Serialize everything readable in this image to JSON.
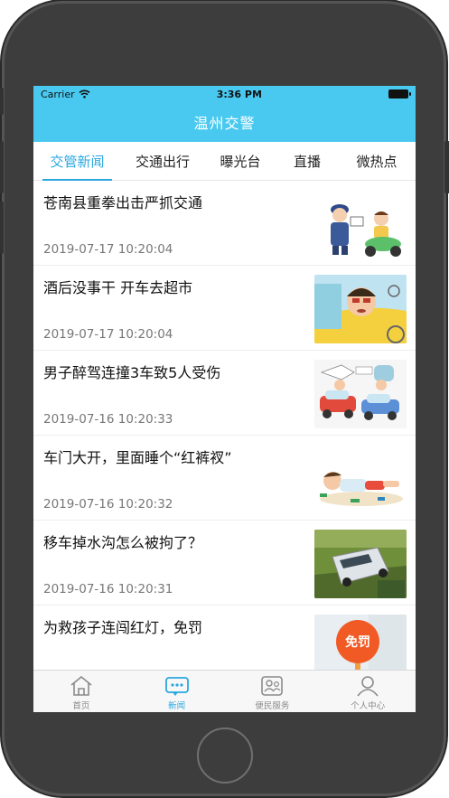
{
  "status_bar": {
    "carrier": "Carrier",
    "time": "3:36 PM"
  },
  "nav": {
    "title": "温州交警"
  },
  "tabs": [
    {
      "label": "交管新闻",
      "active": true
    },
    {
      "label": "交通出行",
      "active": false
    },
    {
      "label": "曝光台",
      "active": false
    },
    {
      "label": "直播",
      "active": false
    },
    {
      "label": "微热点",
      "active": false
    }
  ],
  "news": [
    {
      "title": "苍南县重拳出击严抓交通",
      "time": "2019-07-17 10:20:04",
      "thumb_icon": "police-traffic-stop-illustration"
    },
    {
      "title": "酒后没事干 开车去超市",
      "time": "2019-07-17 10:20:04",
      "thumb_icon": "drunk-driver-illustration"
    },
    {
      "title": "男子醉驾连撞3车致5人受伤",
      "time": "2019-07-16 10:20:33",
      "thumb_icon": "car-collision-illustration"
    },
    {
      "title": "车门大开，里面睡个“红裤衩”",
      "time": "2019-07-16 10:20:32",
      "thumb_icon": "sleeping-man-illustration"
    },
    {
      "title": "移车掉水沟怎么被拘了？",
      "time": "2019-07-16 10:20:31",
      "thumb_icon": "car-in-ditch-photo"
    },
    {
      "title": "为救孩子连闯红灯，免罚",
      "time": "",
      "thumb_icon": "fine-exempt-sign",
      "thumb_text": "免罚"
    }
  ],
  "tabbar": [
    {
      "label": "首页",
      "icon": "home-icon",
      "active": false
    },
    {
      "label": "新闻",
      "icon": "message-icon",
      "active": true
    },
    {
      "label": "便民服务",
      "icon": "service-icon",
      "active": false
    },
    {
      "label": "个人中心",
      "icon": "person-icon",
      "active": false
    }
  ],
  "colors": {
    "accent": "#49c9ef",
    "active_tab": "#2aa8e0"
  }
}
